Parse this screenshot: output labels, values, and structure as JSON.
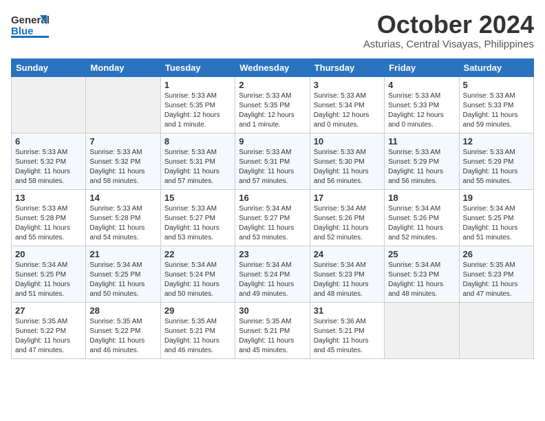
{
  "header": {
    "logo_general": "General",
    "logo_blue": "Blue",
    "month_year": "October 2024",
    "location": "Asturias, Central Visayas, Philippines"
  },
  "columns": [
    "Sunday",
    "Monday",
    "Tuesday",
    "Wednesday",
    "Thursday",
    "Friday",
    "Saturday"
  ],
  "weeks": [
    [
      {
        "day": "",
        "info": ""
      },
      {
        "day": "",
        "info": ""
      },
      {
        "day": "1",
        "info": "Sunrise: 5:33 AM\nSunset: 5:35 PM\nDaylight: 12 hours\nand 1 minute."
      },
      {
        "day": "2",
        "info": "Sunrise: 5:33 AM\nSunset: 5:35 PM\nDaylight: 12 hours\nand 1 minute."
      },
      {
        "day": "3",
        "info": "Sunrise: 5:33 AM\nSunset: 5:34 PM\nDaylight: 12 hours\nand 0 minutes."
      },
      {
        "day": "4",
        "info": "Sunrise: 5:33 AM\nSunset: 5:33 PM\nDaylight: 12 hours\nand 0 minutes."
      },
      {
        "day": "5",
        "info": "Sunrise: 5:33 AM\nSunset: 5:33 PM\nDaylight: 11 hours\nand 59 minutes."
      }
    ],
    [
      {
        "day": "6",
        "info": "Sunrise: 5:33 AM\nSunset: 5:32 PM\nDaylight: 11 hours\nand 58 minutes."
      },
      {
        "day": "7",
        "info": "Sunrise: 5:33 AM\nSunset: 5:32 PM\nDaylight: 11 hours\nand 58 minutes."
      },
      {
        "day": "8",
        "info": "Sunrise: 5:33 AM\nSunset: 5:31 PM\nDaylight: 11 hours\nand 57 minutes."
      },
      {
        "day": "9",
        "info": "Sunrise: 5:33 AM\nSunset: 5:31 PM\nDaylight: 11 hours\nand 57 minutes."
      },
      {
        "day": "10",
        "info": "Sunrise: 5:33 AM\nSunset: 5:30 PM\nDaylight: 11 hours\nand 56 minutes."
      },
      {
        "day": "11",
        "info": "Sunrise: 5:33 AM\nSunset: 5:29 PM\nDaylight: 11 hours\nand 56 minutes."
      },
      {
        "day": "12",
        "info": "Sunrise: 5:33 AM\nSunset: 5:29 PM\nDaylight: 11 hours\nand 55 minutes."
      }
    ],
    [
      {
        "day": "13",
        "info": "Sunrise: 5:33 AM\nSunset: 5:28 PM\nDaylight: 11 hours\nand 55 minutes."
      },
      {
        "day": "14",
        "info": "Sunrise: 5:33 AM\nSunset: 5:28 PM\nDaylight: 11 hours\nand 54 minutes."
      },
      {
        "day": "15",
        "info": "Sunrise: 5:33 AM\nSunset: 5:27 PM\nDaylight: 11 hours\nand 53 minutes."
      },
      {
        "day": "16",
        "info": "Sunrise: 5:34 AM\nSunset: 5:27 PM\nDaylight: 11 hours\nand 53 minutes."
      },
      {
        "day": "17",
        "info": "Sunrise: 5:34 AM\nSunset: 5:26 PM\nDaylight: 11 hours\nand 52 minutes."
      },
      {
        "day": "18",
        "info": "Sunrise: 5:34 AM\nSunset: 5:26 PM\nDaylight: 11 hours\nand 52 minutes."
      },
      {
        "day": "19",
        "info": "Sunrise: 5:34 AM\nSunset: 5:25 PM\nDaylight: 11 hours\nand 51 minutes."
      }
    ],
    [
      {
        "day": "20",
        "info": "Sunrise: 5:34 AM\nSunset: 5:25 PM\nDaylight: 11 hours\nand 51 minutes."
      },
      {
        "day": "21",
        "info": "Sunrise: 5:34 AM\nSunset: 5:25 PM\nDaylight: 11 hours\nand 50 minutes."
      },
      {
        "day": "22",
        "info": "Sunrise: 5:34 AM\nSunset: 5:24 PM\nDaylight: 11 hours\nand 50 minutes."
      },
      {
        "day": "23",
        "info": "Sunrise: 5:34 AM\nSunset: 5:24 PM\nDaylight: 11 hours\nand 49 minutes."
      },
      {
        "day": "24",
        "info": "Sunrise: 5:34 AM\nSunset: 5:23 PM\nDaylight: 11 hours\nand 48 minutes."
      },
      {
        "day": "25",
        "info": "Sunrise: 5:34 AM\nSunset: 5:23 PM\nDaylight: 11 hours\nand 48 minutes."
      },
      {
        "day": "26",
        "info": "Sunrise: 5:35 AM\nSunset: 5:23 PM\nDaylight: 11 hours\nand 47 minutes."
      }
    ],
    [
      {
        "day": "27",
        "info": "Sunrise: 5:35 AM\nSunset: 5:22 PM\nDaylight: 11 hours\nand 47 minutes."
      },
      {
        "day": "28",
        "info": "Sunrise: 5:35 AM\nSunset: 5:22 PM\nDaylight: 11 hours\nand 46 minutes."
      },
      {
        "day": "29",
        "info": "Sunrise: 5:35 AM\nSunset: 5:21 PM\nDaylight: 11 hours\nand 46 minutes."
      },
      {
        "day": "30",
        "info": "Sunrise: 5:35 AM\nSunset: 5:21 PM\nDaylight: 11 hours\nand 45 minutes."
      },
      {
        "day": "31",
        "info": "Sunrise: 5:36 AM\nSunset: 5:21 PM\nDaylight: 11 hours\nand 45 minutes."
      },
      {
        "day": "",
        "info": ""
      },
      {
        "day": "",
        "info": ""
      }
    ]
  ]
}
